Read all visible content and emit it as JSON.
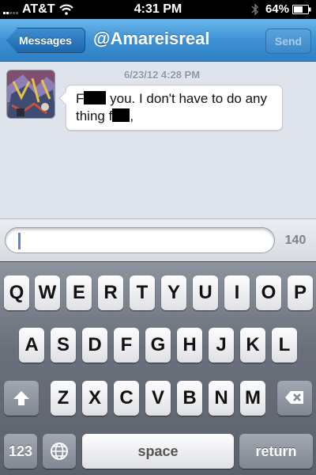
{
  "status_bar": {
    "carrier": "AT&T",
    "time": "4:31 PM",
    "battery": "64%"
  },
  "nav": {
    "back_label": "Messages",
    "title": "@Amareisreal",
    "send_label": "Send"
  },
  "conversation": {
    "timestamp": "6/23/12 4:28 PM",
    "message": {
      "part1": "F",
      "part2": " you. I don't have to do any thing f",
      "part3": ","
    }
  },
  "composer": {
    "value": "",
    "counter": "140"
  },
  "keyboard": {
    "row1": [
      "Q",
      "W",
      "E",
      "R",
      "T",
      "Y",
      "U",
      "I",
      "O",
      "P"
    ],
    "row2": [
      "A",
      "S",
      "D",
      "F",
      "G",
      "H",
      "J",
      "K",
      "L"
    ],
    "row3": [
      "Z",
      "X",
      "C",
      "V",
      "B",
      "N",
      "M"
    ],
    "numbers_label": "123",
    "space_label": "space",
    "return_label": "return"
  },
  "colors": {
    "nav_blue": "#3d91d3",
    "background": "#dfe4ec",
    "caret": "#5a86d8"
  }
}
